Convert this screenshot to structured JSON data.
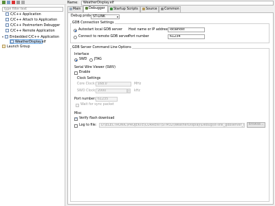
{
  "tree": {
    "filter_placeholder": "type filter text",
    "items": [
      {
        "label": "C/C++ Application"
      },
      {
        "label": "C/C++ Attach to Application"
      },
      {
        "label": "C/C++ Postmortem Debugger"
      },
      {
        "label": "C/C++ Remote Application"
      },
      {
        "label": "Embedded C/C++ Application"
      },
      {
        "label": "WeatherDisplay.elf"
      },
      {
        "label": "Launch Group"
      }
    ]
  },
  "config": {
    "name_label": "Name:",
    "name_value": "WeatherDisplay.elf"
  },
  "tabs": [
    {
      "label": "Main"
    },
    {
      "label": "Debugger"
    },
    {
      "label": "Startup Scripts"
    },
    {
      "label": "Source"
    },
    {
      "label": "Common"
    }
  ],
  "debugger": {
    "probe_label": "Debug probe",
    "probe_value": "ST-LINK",
    "gdb_connection": {
      "title": "GDB Connection Settings",
      "autostart_label": "Autostart local GDB server",
      "remote_label": "Connect to remote GDB server",
      "host_label": "Host name or IP address",
      "host_value": "localhost",
      "port_label": "Port number",
      "port_value": "61234"
    },
    "cmdline": {
      "title": "GDB Server Command Line Options",
      "interface": {
        "title": "Interface",
        "swd_label": "SWD",
        "jtag_label": "JTAG"
      },
      "swv": {
        "title": "Serial Wire Viewer (SWV)",
        "enable_label": "Enable",
        "clock": {
          "title": "Clock Settings",
          "core_label": "Core Clock:",
          "core_value": "168.0",
          "core_unit": "MHz",
          "swo_label": "SWO Clock:",
          "swo_value": "2000",
          "swo_unit": "kHz"
        },
        "port_label": "Port number:",
        "port_value": "61235",
        "wait_label": "Wait for sync packet"
      },
      "misc": {
        "title": "Misc",
        "verify_label": "Verify flash download",
        "log_label": "Log to file:",
        "log_value": "D:\\ELECTRONIC\\PROJEKTE\\CURRENT\\STM32\\WeatherDisplay\\Debug\\st-link_gdbserver_log.",
        "browse_label": "Browse..."
      }
    }
  },
  "colors": {
    "selection": "#cde3fb",
    "accent": "#1a63c7"
  }
}
